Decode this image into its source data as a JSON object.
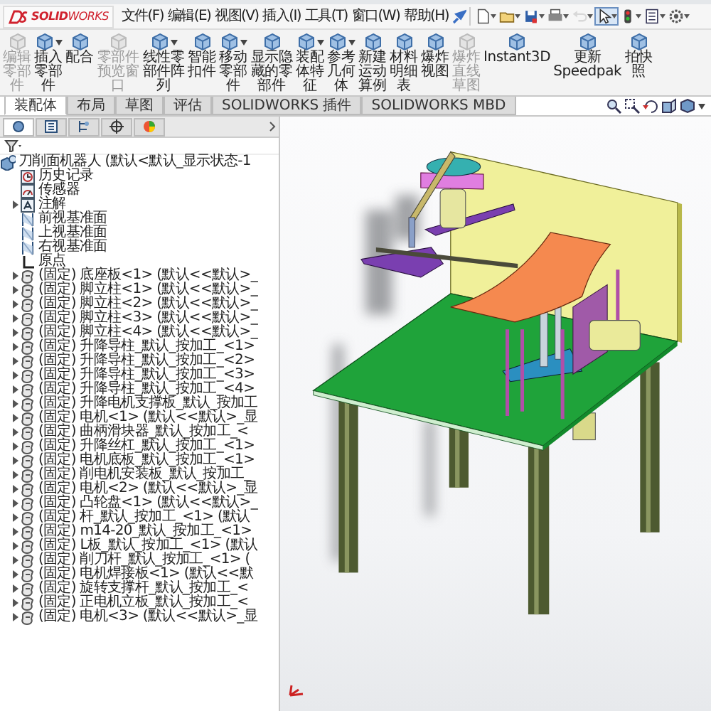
{
  "logo": "**SOLID**WORKS",
  "menu": [
    "文件(F)",
    "编辑(E)",
    "视图(V)",
    "插入(I)",
    "工具(T)",
    "窗口(W)",
    "帮助(H)"
  ],
  "quick_tools": [
    {
      "kind": "new",
      "selected": false,
      "disabled": false
    },
    {
      "kind": "open",
      "selected": false,
      "disabled": false
    },
    {
      "kind": "save",
      "selected": false,
      "disabled": false
    },
    {
      "kind": "print",
      "selected": false,
      "disabled": false
    },
    {
      "kind": "undo",
      "selected": false,
      "disabled": true
    },
    {
      "kind": "select",
      "selected": true,
      "disabled": false
    },
    {
      "kind": "rebuild",
      "selected": false,
      "disabled": false
    },
    {
      "kind": "file-properties",
      "selected": false,
      "disabled": false
    },
    {
      "kind": "options",
      "selected": false,
      "disabled": false
    }
  ],
  "toolbar": [
    {
      "label": "编辑零部件",
      "disabled": true,
      "dropdown": false
    },
    {
      "label": "插入零部件",
      "disabled": false,
      "dropdown": true
    },
    {
      "label": "配合",
      "disabled": false,
      "dropdown": false
    },
    {
      "label": "零部件预览窗口",
      "disabled": true,
      "dropdown": false
    },
    {
      "label": "线性零部件阵列",
      "disabled": false,
      "dropdown": true
    },
    {
      "label": "智能扣件",
      "disabled": false,
      "dropdown": false
    },
    {
      "label": "移动零部件",
      "disabled": false,
      "dropdown": true
    },
    {
      "label": "显示隐藏的零部件",
      "disabled": false,
      "dropdown": false
    },
    {
      "label": "装配体特征",
      "disabled": false,
      "dropdown": true
    },
    {
      "label": "参考几何体",
      "disabled": false,
      "dropdown": true
    },
    {
      "label": "新建运动算例",
      "disabled": false,
      "dropdown": false
    },
    {
      "label": "材料明细表",
      "disabled": false,
      "dropdown": false
    },
    {
      "label": "爆炸视图",
      "disabled": false,
      "dropdown": false
    },
    {
      "label": "爆炸直线草图",
      "disabled": true,
      "dropdown": false
    },
    {
      "label": "Instant3D",
      "disabled": false,
      "dropdown": false
    },
    {
      "label": "更新 Speedpak",
      "disabled": false,
      "dropdown": false
    },
    {
      "label": "拍快照",
      "disabled": false,
      "dropdown": false
    }
  ],
  "tabs": [
    {
      "label": "装配体",
      "selected": true
    },
    {
      "label": "布局",
      "selected": false
    },
    {
      "label": "草图",
      "selected": false
    },
    {
      "label": "评估",
      "selected": false
    },
    {
      "label": "SOLIDWORKS 插件",
      "selected": false
    },
    {
      "label": "SOLIDWORKS MBD",
      "selected": false
    }
  ],
  "panel_tabs": [
    {
      "selected": true
    },
    {
      "selected": false
    },
    {
      "selected": false
    },
    {
      "selected": false
    },
    {
      "selected": false
    }
  ],
  "tree": {
    "label": "刀削面机器人 (默认<默认_显示状态-1",
    "kind": "assembly",
    "children": [
      {
        "label": "历史记录",
        "kind": "history",
        "expandable": false
      },
      {
        "label": "传感器",
        "kind": "sensor",
        "expandable": false
      },
      {
        "label": "注解",
        "kind": "annotation",
        "expandable": true
      },
      {
        "label": "前视基准面",
        "kind": "plane",
        "expandable": false
      },
      {
        "label": "上视基准面",
        "kind": "plane",
        "expandable": false
      },
      {
        "label": "右视基准面",
        "kind": "plane",
        "expandable": false
      },
      {
        "label": "原点",
        "kind": "origin",
        "expandable": false
      },
      {
        "label": "(固定) 底座板<1> (默认<<默认>_",
        "kind": "part",
        "expandable": true
      },
      {
        "label": "(固定) 脚立柱<1> (默认<<默认>_",
        "kind": "part",
        "expandable": true
      },
      {
        "label": "(固定) 脚立柱<2> (默认<<默认>_",
        "kind": "part",
        "expandable": true
      },
      {
        "label": "(固定) 脚立柱<3> (默认<<默认>_",
        "kind": "part",
        "expandable": true
      },
      {
        "label": "(固定) 脚立柱<4> (默认<<默认>_",
        "kind": "part",
        "expandable": true
      },
      {
        "label": "(固定) 升降导柱_默认_按加工_<1>",
        "kind": "part",
        "expandable": true
      },
      {
        "label": "(固定) 升降导柱_默认_按加工_<2>",
        "kind": "part",
        "expandable": true
      },
      {
        "label": "(固定) 升降导柱_默认_按加工_<3>",
        "kind": "part",
        "expandable": true
      },
      {
        "label": "(固定) 升降导柱_默认_按加工_<4>",
        "kind": "part",
        "expandable": true
      },
      {
        "label": "(固定) 升降电机支撑板_默认_按加工",
        "kind": "part",
        "expandable": true
      },
      {
        "label": "(固定) 电机<1> (默认<<默认>_显",
        "kind": "part",
        "expandable": true
      },
      {
        "label": "(固定) 曲柄滑块器_默认_按加工_<",
        "kind": "part",
        "expandable": true
      },
      {
        "label": "(固定) 升降丝杠_默认_按加工_<1>",
        "kind": "part",
        "expandable": true
      },
      {
        "label": "(固定) 电机底板_默认_按加工_<1>",
        "kind": "part",
        "expandable": true
      },
      {
        "label": "(固定) 削电机安装板_默认_按加工_",
        "kind": "part",
        "expandable": true
      },
      {
        "label": "(固定) 电机<2> (默认<<默认>_显",
        "kind": "part",
        "expandable": true
      },
      {
        "label": "(固定) 凸轮盘<1> (默认<<默认>_",
        "kind": "part",
        "expandable": true
      },
      {
        "label": "(固定) 杆_默认_按加工_<1> (默认",
        "kind": "part",
        "expandable": true
      },
      {
        "label": "(固定) m14-20_默认_按加工_<1>",
        "kind": "part",
        "expandable": true
      },
      {
        "label": "(固定) L板_默认_按加工_<1> (默认",
        "kind": "part",
        "expandable": true
      },
      {
        "label": "(固定) 削刀杆_默认_按加工_<1> (",
        "kind": "part",
        "expandable": true
      },
      {
        "label": "(固定) 电机焊接板<1> (默认<<默",
        "kind": "part",
        "expandable": true
      },
      {
        "label": "(固定) 旋转支撑杆_默认_按加工_<",
        "kind": "part",
        "expandable": true
      },
      {
        "label": "(固定) 正电机立板_默认_按加工_<",
        "kind": "part",
        "expandable": true
      },
      {
        "label": "(固定) 电机<3> (默认<<默认>_显",
        "kind": "part",
        "expandable": true
      }
    ]
  }
}
